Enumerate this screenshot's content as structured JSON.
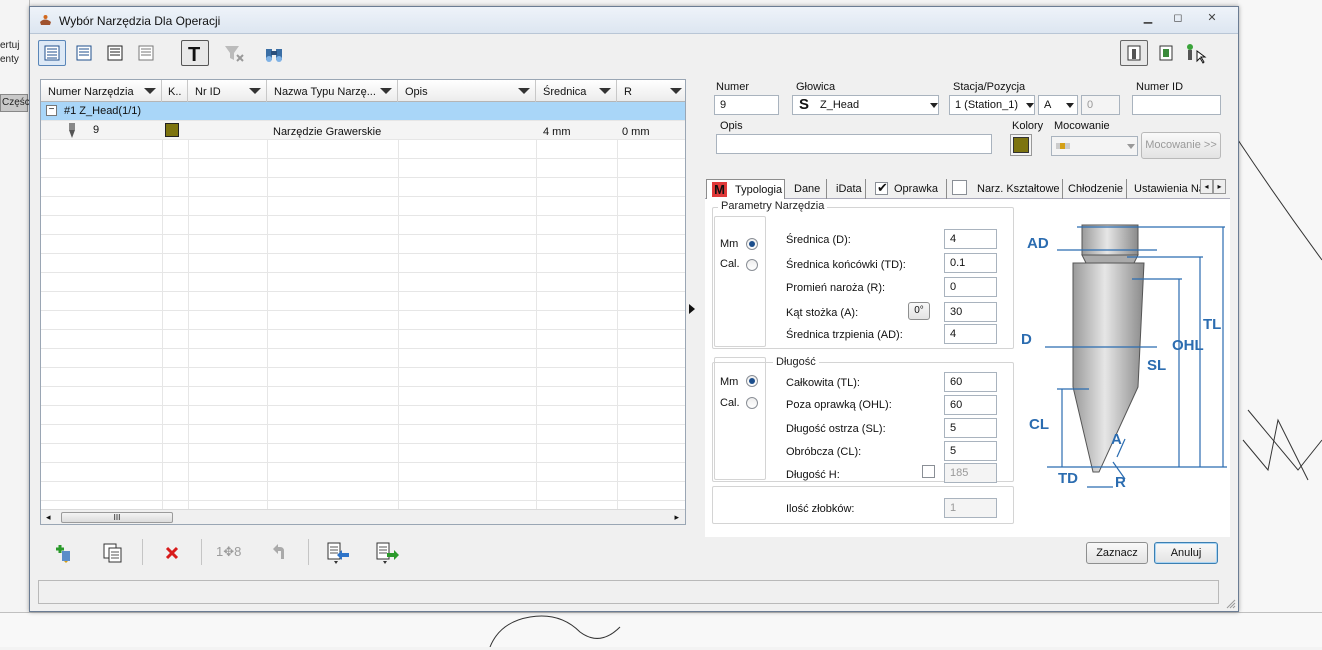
{
  "background": {
    "left_texts": [
      "ertuj",
      "enty"
    ],
    "part_label": "Częśc"
  },
  "window": {
    "title": "Wybór Narzędzia Dla Operacji",
    "controls": [
      "minimize",
      "restore",
      "close"
    ]
  },
  "grid": {
    "columns": [
      "Numer Narzędzia",
      "K..",
      "Nr ID",
      "Nazwa Typu Narzę...",
      "Opis",
      "Średnica",
      "R"
    ],
    "group_row": "#1 Z_Head(1/1)",
    "rows": [
      {
        "numer": "9",
        "kolor": "#7d7410",
        "nr_id": "",
        "nazwa": "Narzędzie Grawerskie",
        "opis": "",
        "srednica": "4 mm",
        "r": "0 mm"
      }
    ],
    "scroll_grip": "III"
  },
  "form": {
    "numer_label": "Numer",
    "numer_value": "9",
    "glowica_label": "Głowica",
    "glowica_value": "Z_Head",
    "stacja_label": "Stacja/Pozycja",
    "stacja_value": "1 (Station_1)",
    "pozycja_value": "A",
    "pozycja_num": "0",
    "numer_id_label": "Numer ID",
    "numer_id_value": "",
    "opis_label": "Opis",
    "opis_value": "",
    "kolory_label": "Kolory",
    "kolor_value": "#7d7410",
    "mocowanie_label": "Mocowanie",
    "mocowanie_button": "Mocowanie >>"
  },
  "tabs": [
    {
      "label": "Typologia",
      "active": true
    },
    {
      "label": "Dane"
    },
    {
      "label": "iData"
    },
    {
      "label": "Oprawka",
      "checked": true
    },
    {
      "label": "Narz. Kształtowe",
      "checked": false
    },
    {
      "label": "Chłodzenie"
    },
    {
      "label": "Ustawienia Na"
    }
  ],
  "parametry": {
    "title": "Parametry Narzędzia",
    "unit_mm": "Mm",
    "unit_cal": "Cal.",
    "fields": [
      {
        "label": "Średnica (D):",
        "value": "4"
      },
      {
        "label": "Średnica końcówki (TD):",
        "value": "0.1"
      },
      {
        "label": "Promień naroża (R):",
        "value": "0"
      },
      {
        "label": "Kąt stożka (A):",
        "value": "30",
        "extra": "0°"
      },
      {
        "label": "Średnica trzpienia (AD):",
        "value": "4"
      }
    ]
  },
  "dlugosc": {
    "title": "Długość",
    "unit_mm": "Mm",
    "unit_cal": "Cal.",
    "fields": [
      {
        "label": "Całkowita (TL):",
        "value": "60"
      },
      {
        "label": "Poza oprawką (OHL):",
        "value": "60"
      },
      {
        "label": "Długość ostrza (SL):",
        "value": "5"
      },
      {
        "label": "Obróbcza (CL):",
        "value": "5"
      },
      {
        "label": "Długość H:",
        "value": "185",
        "disabled": true
      }
    ]
  },
  "ilosc": {
    "label": "Ilość złobków:",
    "value": "1"
  },
  "diagram": {
    "labels": {
      "AD": "AD",
      "D": "D",
      "TL": "TL",
      "OHL": "OHL",
      "SL": "SL",
      "CL": "CL",
      "A": "A",
      "TD": "TD",
      "R": "R"
    },
    "accent": "#2b6cb0"
  },
  "bottom_toolbar": {
    "renumber_label": "1✥8"
  },
  "dialog_buttons": {
    "select": "Zaznacz",
    "cancel": "Anuluj"
  }
}
